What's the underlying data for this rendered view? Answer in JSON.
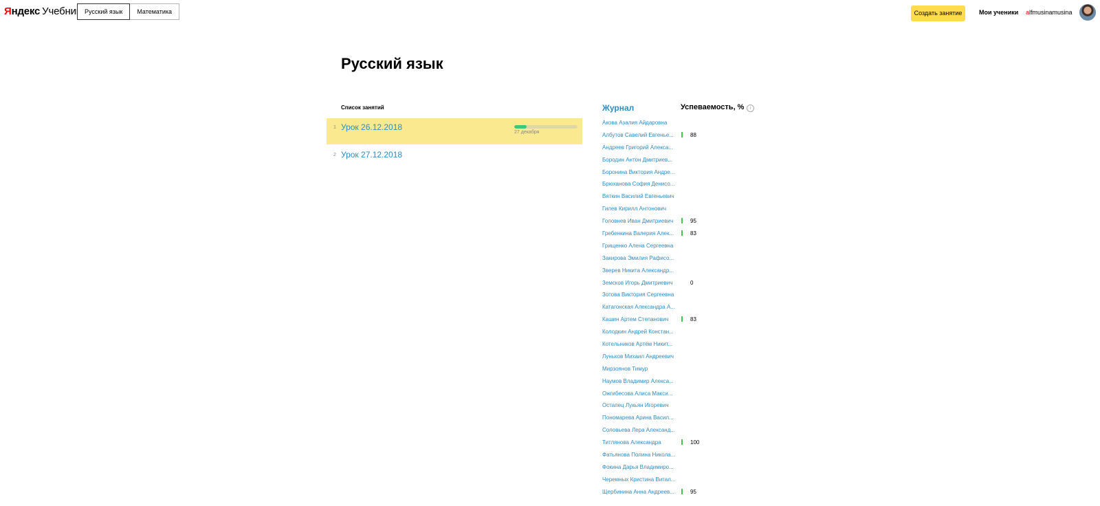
{
  "header": {
    "logo_y": "Я",
    "logo_rest": "ндекс",
    "logo_sub": "Учебник",
    "tabs": [
      "Русский язык",
      "Математика"
    ],
    "create_button": "Создать занятие",
    "my_students": "Мои ученики",
    "user_first": "a",
    "user_rest": "lfmusinamusina"
  },
  "page": {
    "title": "Русский язык"
  },
  "lessons": {
    "header": "Список занятий",
    "items": [
      {
        "num": "1",
        "title": "Урок 26.12.2018",
        "date": "27 декабря",
        "progress": 0.2
      },
      {
        "num": "2",
        "title": "Урок 27.12.2018"
      }
    ]
  },
  "journal": {
    "title": "Журнал",
    "perf_title": "Успеваемость, %",
    "info_icon": "info-icon",
    "bar_color": "#3ec84c",
    "students": [
      {
        "name": "Акова Азалия Айдаровна",
        "score": ""
      },
      {
        "name": "Албутов Савелий Евгенье...",
        "score": "88"
      },
      {
        "name": "Андреев Григорий Алекса...",
        "score": ""
      },
      {
        "name": "Бородин Антон Дмитриев...",
        "score": ""
      },
      {
        "name": "Боронина Виктория Андре...",
        "score": ""
      },
      {
        "name": "Брюханова София Денисо...",
        "score": ""
      },
      {
        "name": "Вяткин Василий Евгеньевич",
        "score": ""
      },
      {
        "name": "Гилев Кирилл Антонович",
        "score": ""
      },
      {
        "name": "Головнев Иван Дмитриевич",
        "score": "95"
      },
      {
        "name": "Гребенкина Валерия Алек...",
        "score": "83"
      },
      {
        "name": "Грищенко Алена Сергеевна",
        "score": ""
      },
      {
        "name": "Закирова Эмилия Рафисо...",
        "score": ""
      },
      {
        "name": "Зверев Никита Александр...",
        "score": ""
      },
      {
        "name": "Земсков Игорь Дмитриевич",
        "score": "0"
      },
      {
        "name": "Зотова Виктория Сергеевна",
        "score": ""
      },
      {
        "name": "Катагонская Александра А...",
        "score": ""
      },
      {
        "name": "Кашин Артем Степанович",
        "score": "83"
      },
      {
        "name": "Колодкин Андрей Констан...",
        "score": ""
      },
      {
        "name": "Котельников Артём Никит...",
        "score": ""
      },
      {
        "name": "Луньков Михаил Андреевич",
        "score": ""
      },
      {
        "name": "Мирзоянов Тимур",
        "score": ""
      },
      {
        "name": "Наумов Владимир Алекса...",
        "score": ""
      },
      {
        "name": "Ожгибесова Алиса Макси...",
        "score": ""
      },
      {
        "name": "Остапец Лукьян Игоревич",
        "score": ""
      },
      {
        "name": "Пономарева Арина Васил...",
        "score": ""
      },
      {
        "name": "Соловьева Лера Александ...",
        "score": ""
      },
      {
        "name": "Титлянова Александра",
        "score": "100"
      },
      {
        "name": "Фатьянова Полина Никола...",
        "score": ""
      },
      {
        "name": "Фокина Дарья Владимиро...",
        "score": ""
      },
      {
        "name": "Черемных Кристина Витал...",
        "score": ""
      },
      {
        "name": "Щербинина Анна Андреев...",
        "score": "95"
      }
    ]
  }
}
